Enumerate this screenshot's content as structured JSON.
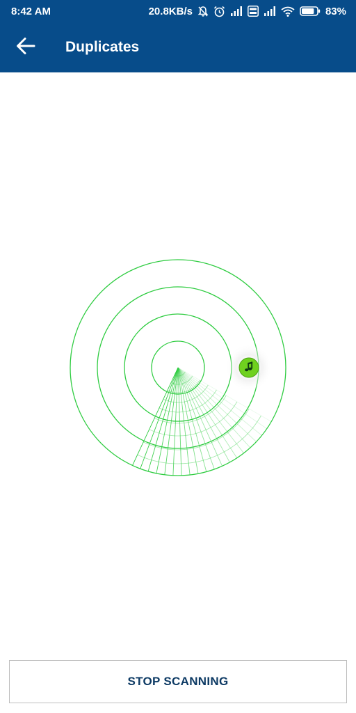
{
  "status_bar": {
    "time": "8:42 AM",
    "network_speed": "20.8KB/s",
    "battery_percent": "83%",
    "battery_level": 0.83,
    "icons": [
      "bell-off-icon",
      "alarm-icon",
      "signal-icon",
      "volte-icon",
      "signal-icon",
      "wifi-icon",
      "battery-icon"
    ]
  },
  "toolbar": {
    "back_icon": "arrow-back-icon",
    "title": "Duplicates"
  },
  "scanner": {
    "found_item_icon": "music-note-icon"
  },
  "actions": {
    "stop_label": "STOP SCANNING"
  },
  "colors": {
    "primary": "#074c8a",
    "radar_green": "#2ecc40",
    "button_text": "#0d3a64",
    "button_border": "#bdbdbd"
  }
}
